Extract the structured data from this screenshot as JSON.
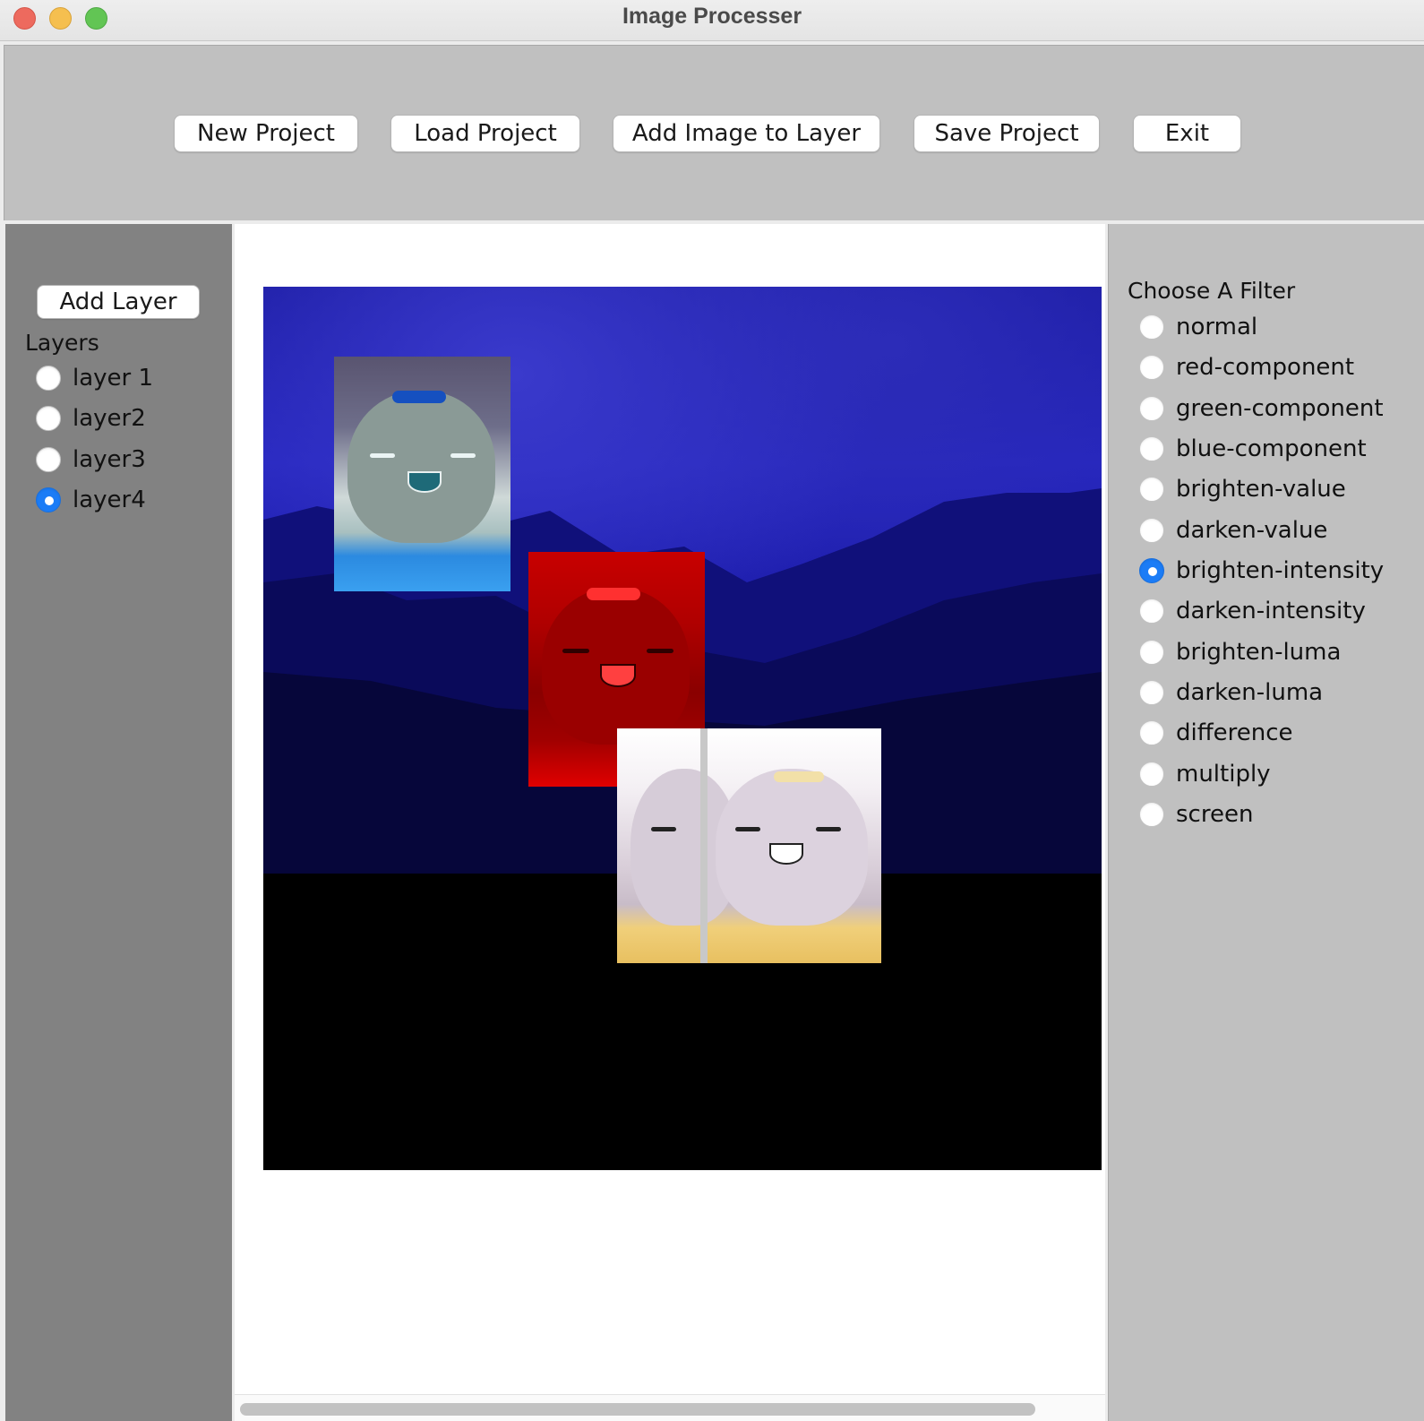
{
  "window": {
    "title": "Image Processer"
  },
  "toolbar": {
    "buttons": [
      "New Project",
      "Load Project",
      "Add Image to Layer",
      "Save Project",
      "Exit"
    ]
  },
  "layers_panel": {
    "add_layer_label": "Add Layer",
    "title": "Layers",
    "items": [
      "layer 1",
      "layer2",
      "layer3",
      "layer4"
    ],
    "selected": "layer4"
  },
  "filter_panel": {
    "title": "Choose A Filter",
    "items": [
      "normal",
      "red-component",
      "green-component",
      "blue-component",
      "brighten-value",
      "darken-value",
      "brighten-intensity",
      "darken-intensity",
      "brighten-luma",
      "darken-luma",
      "difference",
      "multiply",
      "screen"
    ],
    "selected": "brighten-intensity"
  },
  "colors": {
    "accent": "#1b7cf6",
    "toolbar_bg": "#c0c0c0",
    "left_panel_bg": "#828282"
  },
  "scrollbar": {
    "horizontal_fraction_visible": 0.91
  }
}
